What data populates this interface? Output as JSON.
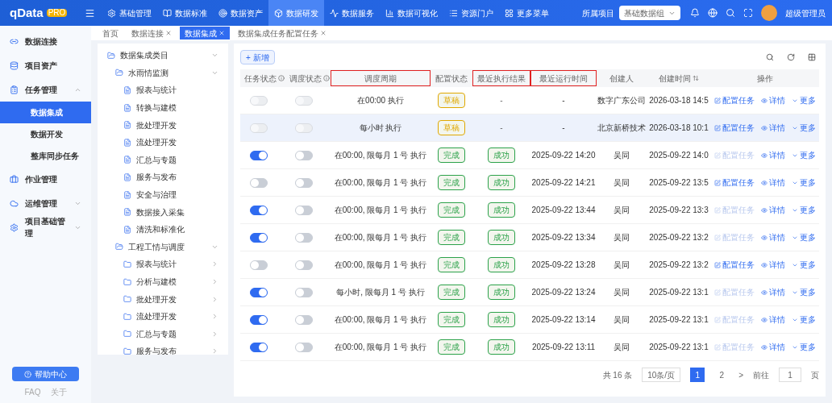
{
  "header": {
    "logo": "qData",
    "logo_badge": "PRO",
    "nav": [
      {
        "label": "基础管理",
        "selected": false
      },
      {
        "label": "数据标准",
        "selected": false
      },
      {
        "label": "数据资产",
        "selected": false
      },
      {
        "label": "数据研发",
        "selected": true
      },
      {
        "label": "数据服务",
        "selected": false
      },
      {
        "label": "数据可视化",
        "selected": false
      },
      {
        "label": "资源门户",
        "selected": false
      },
      {
        "label": "更多菜单",
        "selected": false
      }
    ],
    "project_label": "所属项目",
    "project_value": "基础数据组",
    "user": "超级管理员"
  },
  "tabs": [
    {
      "label": "首页",
      "selected": false,
      "closable": false
    },
    {
      "label": "数据连接",
      "selected": false,
      "closable": true
    },
    {
      "label": "数据集成",
      "selected": true,
      "closable": true
    },
    {
      "label": "数据集成任务配置任务",
      "selected": false,
      "closable": true
    }
  ],
  "sidebar": {
    "items": [
      {
        "label": "数据连接"
      },
      {
        "label": "项目资产"
      },
      {
        "label": "任务管理",
        "expanded": true,
        "children": [
          {
            "label": "数据集成",
            "selected": true
          },
          {
            "label": "数据开发",
            "selected": false
          },
          {
            "label": "整库同步任务",
            "selected": false
          }
        ]
      },
      {
        "label": "作业管理"
      },
      {
        "label": "运维管理",
        "expanded": false
      },
      {
        "label": "项目基础管理",
        "expanded": false
      }
    ],
    "help_button": "帮助中心",
    "links": [
      "FAQ",
      "关于"
    ]
  },
  "tree": {
    "label": "数据集成类目",
    "kind": "folder",
    "expanded": true,
    "children": [
      {
        "label": "水雨情监测",
        "kind": "folder",
        "expanded": true,
        "children": [
          {
            "label": "报表与统计",
            "kind": "leaf"
          },
          {
            "label": "转换与建模",
            "kind": "leaf"
          },
          {
            "label": "批处理开发",
            "kind": "leaf"
          },
          {
            "label": "流处理开发",
            "kind": "leaf"
          },
          {
            "label": "汇总与专题",
            "kind": "leaf"
          },
          {
            "label": "服务与发布",
            "kind": "leaf"
          },
          {
            "label": "安全与治理",
            "kind": "leaf"
          },
          {
            "label": "数据接入采集",
            "kind": "leaf"
          },
          {
            "label": "清洗和标准化",
            "kind": "leaf"
          }
        ]
      },
      {
        "label": "工程工情与调度",
        "kind": "folder",
        "expanded": true,
        "children": [
          {
            "label": "报表与统计",
            "kind": "folder",
            "expanded": false
          },
          {
            "label": "分析与建模",
            "kind": "folder",
            "expanded": false
          },
          {
            "label": "批处理开发",
            "kind": "folder",
            "expanded": false
          },
          {
            "label": "流处理开发",
            "kind": "folder",
            "expanded": false
          },
          {
            "label": "汇总与专题",
            "kind": "folder",
            "expanded": false
          },
          {
            "label": "服务与发布",
            "kind": "folder",
            "expanded": false
          }
        ]
      }
    ]
  },
  "table": {
    "add_button": "+ 新增",
    "columns": [
      {
        "label": "任务状态",
        "info": true,
        "highlighted": false,
        "sortable": false
      },
      {
        "label": "调度状态",
        "info": true,
        "highlighted": false,
        "sortable": false
      },
      {
        "label": "调度周期",
        "info": false,
        "highlighted": true,
        "sortable": false
      },
      {
        "label": "配置状态",
        "info": false,
        "highlighted": false,
        "sortable": false
      },
      {
        "label": "最近执行结果",
        "info": false,
        "highlighted": true,
        "sortable": false
      },
      {
        "label": "最近运行时间",
        "info": false,
        "highlighted": true,
        "sortable": false
      },
      {
        "label": "创建人",
        "info": false,
        "highlighted": false,
        "sortable": false
      },
      {
        "label": "创建时间",
        "info": false,
        "highlighted": false,
        "sortable": true
      },
      {
        "label": "操作",
        "info": false,
        "highlighted": false,
        "sortable": false
      }
    ],
    "rows": [
      {
        "selected": false,
        "task_on": false,
        "toggles_disabled": true,
        "schedule_on": false,
        "cycle": "在00:00 执行",
        "config": {
          "label": "草稿",
          "color": "#e0a800"
        },
        "result": {
          "label": "-"
        },
        "run_time": "-",
        "creator": "数字广东公司",
        "created": "2026-03-18 14:5",
        "actions": [
          {
            "label": "配置任务",
            "disabled": false
          },
          {
            "label": "详情",
            "disabled": false
          },
          {
            "label": "更多",
            "disabled": false
          }
        ]
      },
      {
        "selected": true,
        "task_on": false,
        "toggles_disabled": true,
        "schedule_on": false,
        "cycle": "每小时 执行",
        "config": {
          "label": "草稿",
          "color": "#e0a800"
        },
        "result": {
          "label": "-"
        },
        "run_time": "-",
        "creator": "北京新桥技术",
        "created": "2026-03-18 10:1",
        "actions": [
          {
            "label": "配置任务",
            "disabled": false
          },
          {
            "label": "详情",
            "disabled": false
          },
          {
            "label": "更多",
            "disabled": false
          }
        ]
      },
      {
        "selected": false,
        "task_on": true,
        "toggles_disabled": false,
        "schedule_on": false,
        "cycle": "在00:00, 限每月 1 号 执行",
        "config": {
          "label": "完成",
          "color": "#2ca24a"
        },
        "result": {
          "label": "成功",
          "color": "#2ca24a"
        },
        "run_time": "2025-09-22 14:20",
        "creator": "吴同",
        "created": "2025-09-22 14:0",
        "actions": [
          {
            "label": "配置任务",
            "disabled": true
          },
          {
            "label": "详情",
            "disabled": false
          },
          {
            "label": "更多",
            "disabled": false
          }
        ]
      },
      {
        "selected": false,
        "task_on": false,
        "toggles_disabled": false,
        "schedule_on": false,
        "cycle": "在00:00, 限每月 1 号 执行",
        "config": {
          "label": "完成",
          "color": "#2ca24a"
        },
        "result": {
          "label": "成功",
          "color": "#2ca24a"
        },
        "run_time": "2025-09-22 14:21",
        "creator": "吴同",
        "created": "2025-09-22 13:5",
        "actions": [
          {
            "label": "配置任务",
            "disabled": false
          },
          {
            "label": "详情",
            "disabled": false
          },
          {
            "label": "更多",
            "disabled": false
          }
        ]
      },
      {
        "selected": false,
        "task_on": true,
        "toggles_disabled": false,
        "schedule_on": false,
        "cycle": "在00:00, 限每月 1 号 执行",
        "config": {
          "label": "完成",
          "color": "#2ca24a"
        },
        "result": {
          "label": "成功",
          "color": "#2ca24a"
        },
        "run_time": "2025-09-22 13:44",
        "creator": "吴同",
        "created": "2025-09-22 13:3",
        "actions": [
          {
            "label": "配置任务",
            "disabled": true
          },
          {
            "label": "详情",
            "disabled": false
          },
          {
            "label": "更多",
            "disabled": false
          }
        ]
      },
      {
        "selected": false,
        "task_on": true,
        "toggles_disabled": false,
        "schedule_on": false,
        "cycle": "在00:00, 限每月 1 号 执行",
        "config": {
          "label": "完成",
          "color": "#2ca24a"
        },
        "result": {
          "label": "成功",
          "color": "#2ca24a"
        },
        "run_time": "2025-09-22 13:34",
        "creator": "吴同",
        "created": "2025-09-22 13:2",
        "actions": [
          {
            "label": "配置任务",
            "disabled": true
          },
          {
            "label": "详情",
            "disabled": false
          },
          {
            "label": "更多",
            "disabled": false
          }
        ]
      },
      {
        "selected": false,
        "task_on": false,
        "toggles_disabled": false,
        "schedule_on": false,
        "cycle": "在00:00, 限每月 1 号 执行",
        "config": {
          "label": "完成",
          "color": "#2ca24a"
        },
        "result": {
          "label": "成功",
          "color": "#2ca24a"
        },
        "run_time": "2025-09-22 13:28",
        "creator": "吴同",
        "created": "2025-09-22 13:2",
        "actions": [
          {
            "label": "配置任务",
            "disabled": false
          },
          {
            "label": "详情",
            "disabled": false
          },
          {
            "label": "更多",
            "disabled": false
          }
        ]
      },
      {
        "selected": false,
        "task_on": true,
        "toggles_disabled": false,
        "schedule_on": false,
        "cycle": "每小时, 限每月 1 号 执行",
        "config": {
          "label": "完成",
          "color": "#2ca24a"
        },
        "result": {
          "label": "成功",
          "color": "#2ca24a"
        },
        "run_time": "2025-09-22 13:24",
        "creator": "吴同",
        "created": "2025-09-22 13:1",
        "actions": [
          {
            "label": "配置任务",
            "disabled": true
          },
          {
            "label": "详情",
            "disabled": false
          },
          {
            "label": "更多",
            "disabled": false
          }
        ]
      },
      {
        "selected": false,
        "task_on": true,
        "toggles_disabled": false,
        "schedule_on": false,
        "cycle": "在00:00, 限每月 1 号 执行",
        "config": {
          "label": "完成",
          "color": "#2ca24a"
        },
        "result": {
          "label": "成功",
          "color": "#2ca24a"
        },
        "run_time": "2025-09-22 13:14",
        "creator": "吴同",
        "created": "2025-09-22 13:1",
        "actions": [
          {
            "label": "配置任务",
            "disabled": true
          },
          {
            "label": "详情",
            "disabled": false
          },
          {
            "label": "更多",
            "disabled": false
          }
        ]
      },
      {
        "selected": false,
        "task_on": true,
        "toggles_disabled": false,
        "schedule_on": false,
        "cycle": "在00:00, 限每月 1 号 执行",
        "config": {
          "label": "完成",
          "color": "#2ca24a"
        },
        "result": {
          "label": "成功",
          "color": "#2ca24a"
        },
        "run_time": "2025-09-22 13:11",
        "creator": "吴同",
        "created": "2025-09-22 13:1",
        "actions": [
          {
            "label": "配置任务",
            "disabled": true
          },
          {
            "label": "详情",
            "disabled": false
          },
          {
            "label": "更多",
            "disabled": false
          }
        ]
      }
    ],
    "pagination": {
      "total": "共 16 条",
      "page_size": "10条/页",
      "pages": [
        {
          "label": "1",
          "selected": true
        },
        {
          "label": "2",
          "selected": false
        }
      ],
      "next": ">",
      "goto": "前往",
      "goto_value": "1",
      "page_unit": "页"
    }
  }
}
